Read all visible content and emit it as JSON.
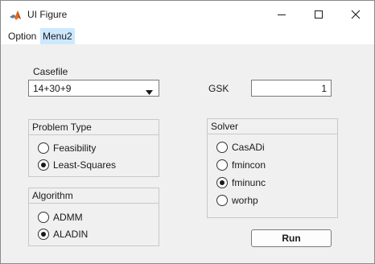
{
  "window": {
    "title": "UI Figure"
  },
  "menu": {
    "items": [
      {
        "label": "Option"
      },
      {
        "label": "Menu2"
      }
    ]
  },
  "casefile": {
    "label": "Casefile",
    "selected": "14+30+9"
  },
  "gsk": {
    "label": "GSK",
    "value": "1"
  },
  "problem_type": {
    "title": "Problem Type",
    "options": [
      {
        "label": "Feasibility",
        "selected": false
      },
      {
        "label": "Least-Squares",
        "selected": true
      }
    ]
  },
  "algorithm": {
    "title": "Algorithm",
    "options": [
      {
        "label": "ADMM",
        "selected": false
      },
      {
        "label": "ALADIN",
        "selected": true
      }
    ]
  },
  "solver": {
    "title": "Solver",
    "options": [
      {
        "label": "CasADi",
        "selected": false
      },
      {
        "label": "fmincon",
        "selected": false
      },
      {
        "label": "fminunc",
        "selected": true
      },
      {
        "label": "worhp",
        "selected": false
      }
    ]
  },
  "run_button": {
    "label": "Run"
  }
}
